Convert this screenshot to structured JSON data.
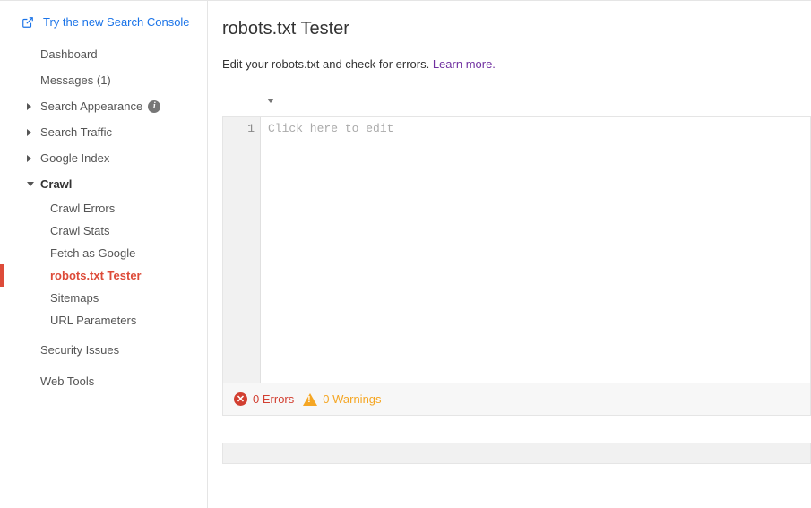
{
  "header": {
    "try_new_link": "Try the new Search Console"
  },
  "sidebar": {
    "dashboard": "Dashboard",
    "messages": "Messages (1)",
    "search_appearance": "Search Appearance",
    "search_traffic": "Search Traffic",
    "google_index": "Google Index",
    "crawl": "Crawl",
    "crawl_children": {
      "crawl_errors": "Crawl Errors",
      "crawl_stats": "Crawl Stats",
      "fetch_as_google": "Fetch as Google",
      "robots_tester": "robots.txt Tester",
      "sitemaps": "Sitemaps",
      "url_parameters": "URL Parameters"
    },
    "security_issues": "Security Issues",
    "web_tools": "Web Tools"
  },
  "main": {
    "title": "robots.txt Tester",
    "subtitle_text": "Edit your robots.txt and check for errors. ",
    "learn_more": "Learn more.",
    "editor": {
      "line_number": "1",
      "placeholder": "Click here to edit"
    },
    "status": {
      "errors_count": "0",
      "errors_label": "Errors",
      "warnings_count": "0",
      "warnings_label": "Warnings"
    }
  }
}
